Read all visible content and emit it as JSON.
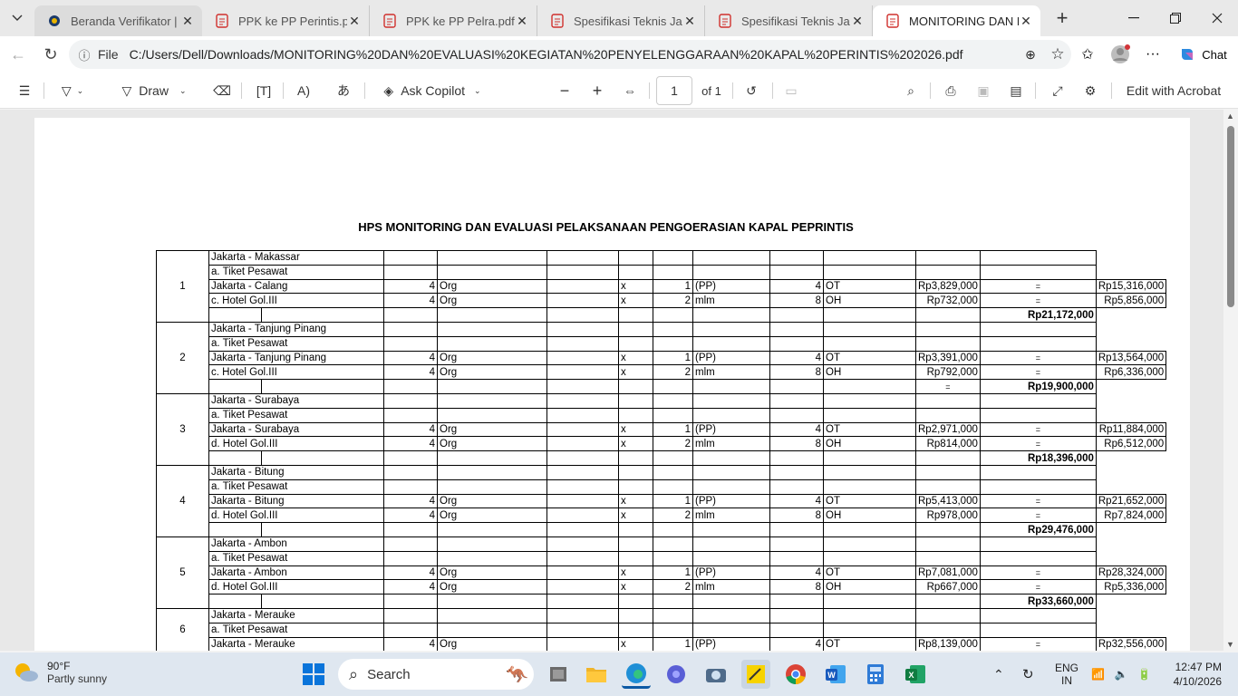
{
  "browser": {
    "tabs": [
      {
        "title": "Beranda Verifikator | Sin",
        "icon": "site-icon"
      },
      {
        "title": "PPK ke PP Perintis.pdf",
        "icon": "pdf-icon"
      },
      {
        "title": "PPK ke PP Pelra.pdf",
        "icon": "pdf-icon"
      },
      {
        "title": "Spesifikasi Teknis Jasa La",
        "icon": "pdf-icon"
      },
      {
        "title": "Spesifikasi Teknis Jasa La",
        "icon": "pdf-icon"
      },
      {
        "title": "MONITORING DAN EVA",
        "icon": "pdf-icon"
      }
    ],
    "address": {
      "label": "File",
      "url": "C:/Users/Dell/Downloads/MONITORING%20DAN%20EVALUASI%20KEGIATAN%20PENYELENGGARAAN%20KAPAL%20PERINTIS%202026.pdf"
    },
    "chat_label": "Chat"
  },
  "pdf_toolbar": {
    "draw_label": "Draw",
    "copilot_label": "Ask Copilot",
    "page_value": "1",
    "page_total": "of 1",
    "edit_label": "Edit with Acrobat"
  },
  "document": {
    "title": "HPS MONITORING DAN EVALUASI PELAKSANAAN PENGOERASIAN KAPAL PEPRINTIS",
    "groups": [
      {
        "no": "1",
        "route": "Jakarta - Makassar",
        "ticket_label": "a. Tiket Pesawat",
        "rows": [
          {
            "item": "Jakarta - Calang",
            "qty": "4",
            "unit": "Org",
            "x": "x",
            "n2": "1",
            "u2": "(PP)",
            "n3": "4",
            "u3": "OT",
            "price": "Rp3,829,000",
            "eq": "=",
            "total": "Rp15,316,000"
          },
          {
            "item": "c. Hotel Gol.III",
            "qty": "4",
            "unit": "Org",
            "x": "x",
            "n2": "2",
            "u2": "mlm",
            "n3": "8",
            "u3": "OH",
            "price": "Rp732,000",
            "eq": "=",
            "total": "Rp5,856,000"
          }
        ],
        "eq_sub": "",
        "subtotal": "Rp21,172,000"
      },
      {
        "no": "2",
        "route": "Jakarta - Tanjung Pinang",
        "ticket_label": "a. Tiket Pesawat",
        "rows": [
          {
            "item": "Jakarta - Tanjung Pinang",
            "qty": "4",
            "unit": "Org",
            "x": "x",
            "n2": "1",
            "u2": "(PP)",
            "n3": "4",
            "u3": "OT",
            "price": "Rp3,391,000",
            "eq": "=",
            "total": "Rp13,564,000"
          },
          {
            "item": "c. Hotel Gol.III",
            "qty": "4",
            "unit": "Org",
            "x": "x",
            "n2": "2",
            "u2": "mlm",
            "n3": "8",
            "u3": "OH",
            "price": "Rp792,000",
            "eq": "=",
            "total": "Rp6,336,000"
          }
        ],
        "eq_sub": "=",
        "subtotal": "Rp19,900,000"
      },
      {
        "no": "3",
        "route": "Jakarta - Surabaya",
        "ticket_label": "a. Tiket Pesawat",
        "rows": [
          {
            "item": "Jakarta - Surabaya",
            "qty": "4",
            "unit": "Org",
            "x": "x",
            "n2": "1",
            "u2": "(PP)",
            "n3": "4",
            "u3": "OT",
            "price": "Rp2,971,000",
            "eq": "=",
            "total": "Rp11,884,000"
          },
          {
            "item": "d. Hotel Gol.III",
            "qty": "4",
            "unit": "Org",
            "x": "x",
            "n2": "2",
            "u2": "mlm",
            "n3": "8",
            "u3": "OH",
            "price": "Rp814,000",
            "eq": "=",
            "total": "Rp6,512,000"
          }
        ],
        "eq_sub": "",
        "subtotal": "Rp18,396,000"
      },
      {
        "no": "4",
        "route": "Jakarta - Bitung",
        "ticket_label": "a. Tiket Pesawat",
        "rows": [
          {
            "item": "Jakarta - Bitung",
            "qty": "4",
            "unit": "Org",
            "x": "x",
            "n2": "1",
            "u2": "(PP)",
            "n3": "4",
            "u3": "OT",
            "price": "Rp5,413,000",
            "eq": "=",
            "total": "Rp21,652,000"
          },
          {
            "item": "d. Hotel Gol.III",
            "qty": "4",
            "unit": "Org",
            "x": "x",
            "n2": "2",
            "u2": "mlm",
            "n3": "8",
            "u3": "OH",
            "price": "Rp978,000",
            "eq": "=",
            "total": "Rp7,824,000"
          }
        ],
        "eq_sub": "",
        "subtotal": "Rp29,476,000"
      },
      {
        "no": "5",
        "route": "Jakarta - Ambon",
        "ticket_label": "a. Tiket Pesawat",
        "rows": [
          {
            "item": "Jakarta - Ambon",
            "qty": "4",
            "unit": "Org",
            "x": "x",
            "n2": "1",
            "u2": "(PP)",
            "n3": "4",
            "u3": "OT",
            "price": "Rp7,081,000",
            "eq": "=",
            "total": "Rp28,324,000"
          },
          {
            "item": "d. Hotel Gol.III",
            "qty": "4",
            "unit": "Org",
            "x": "x",
            "n2": "2",
            "u2": "mlm",
            "n3": "8",
            "u3": "OH",
            "price": "Rp667,000",
            "eq": "=",
            "total": "Rp5,336,000"
          }
        ],
        "eq_sub": "",
        "subtotal": "Rp33,660,000"
      },
      {
        "no": "6",
        "route": "Jakarta - Merauke",
        "ticket_label": "a. Tiket Pesawat",
        "rows": [
          {
            "item": "Jakarta - Merauke",
            "qty": "4",
            "unit": "Org",
            "x": "x",
            "n2": "1",
            "u2": "(PP)",
            "n3": "4",
            "u3": "OT",
            "price": "Rp8,139,000",
            "eq": "=",
            "total": "Rp32,556,000"
          }
        ],
        "eq_sub": "",
        "subtotal": ""
      }
    ]
  },
  "taskbar": {
    "weather_temp": "90°F",
    "weather_cond": "Partly sunny",
    "search_label": "Search",
    "lang_line1": "ENG",
    "lang_line2": "IN",
    "time": "12:47 PM",
    "date": "4/10/2026"
  },
  "colors": {
    "edge_blue": "#0c59a4",
    "excel_green": "#107c41",
    "word_blue": "#185abd",
    "pdf_red": "#d0312d"
  }
}
